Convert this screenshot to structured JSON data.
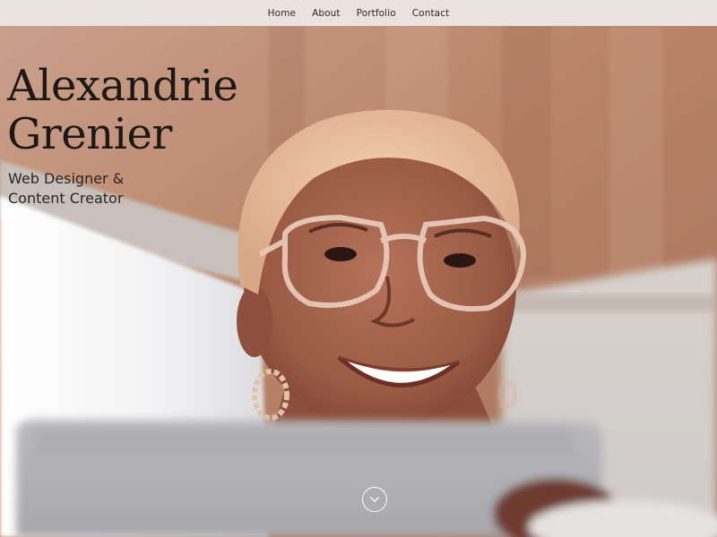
{
  "nav": {
    "items": [
      {
        "label": "Home"
      },
      {
        "label": "About"
      },
      {
        "label": "Portfolio"
      },
      {
        "label": "Contact"
      }
    ]
  },
  "hero": {
    "name_line1": "Alexandrie",
    "name_line2": "Grenier",
    "role_line1": "Web Designer &",
    "role_line2": "Content Creator",
    "scroll_icon": "chevron-down-circle-icon"
  },
  "colors": {
    "nav_background": "#ebe3e0",
    "text_dark": "#1c1816",
    "ceiling_wood": "#b8826a",
    "wall_white": "#f7f7f8",
    "scroll_button": "#ffffff"
  }
}
